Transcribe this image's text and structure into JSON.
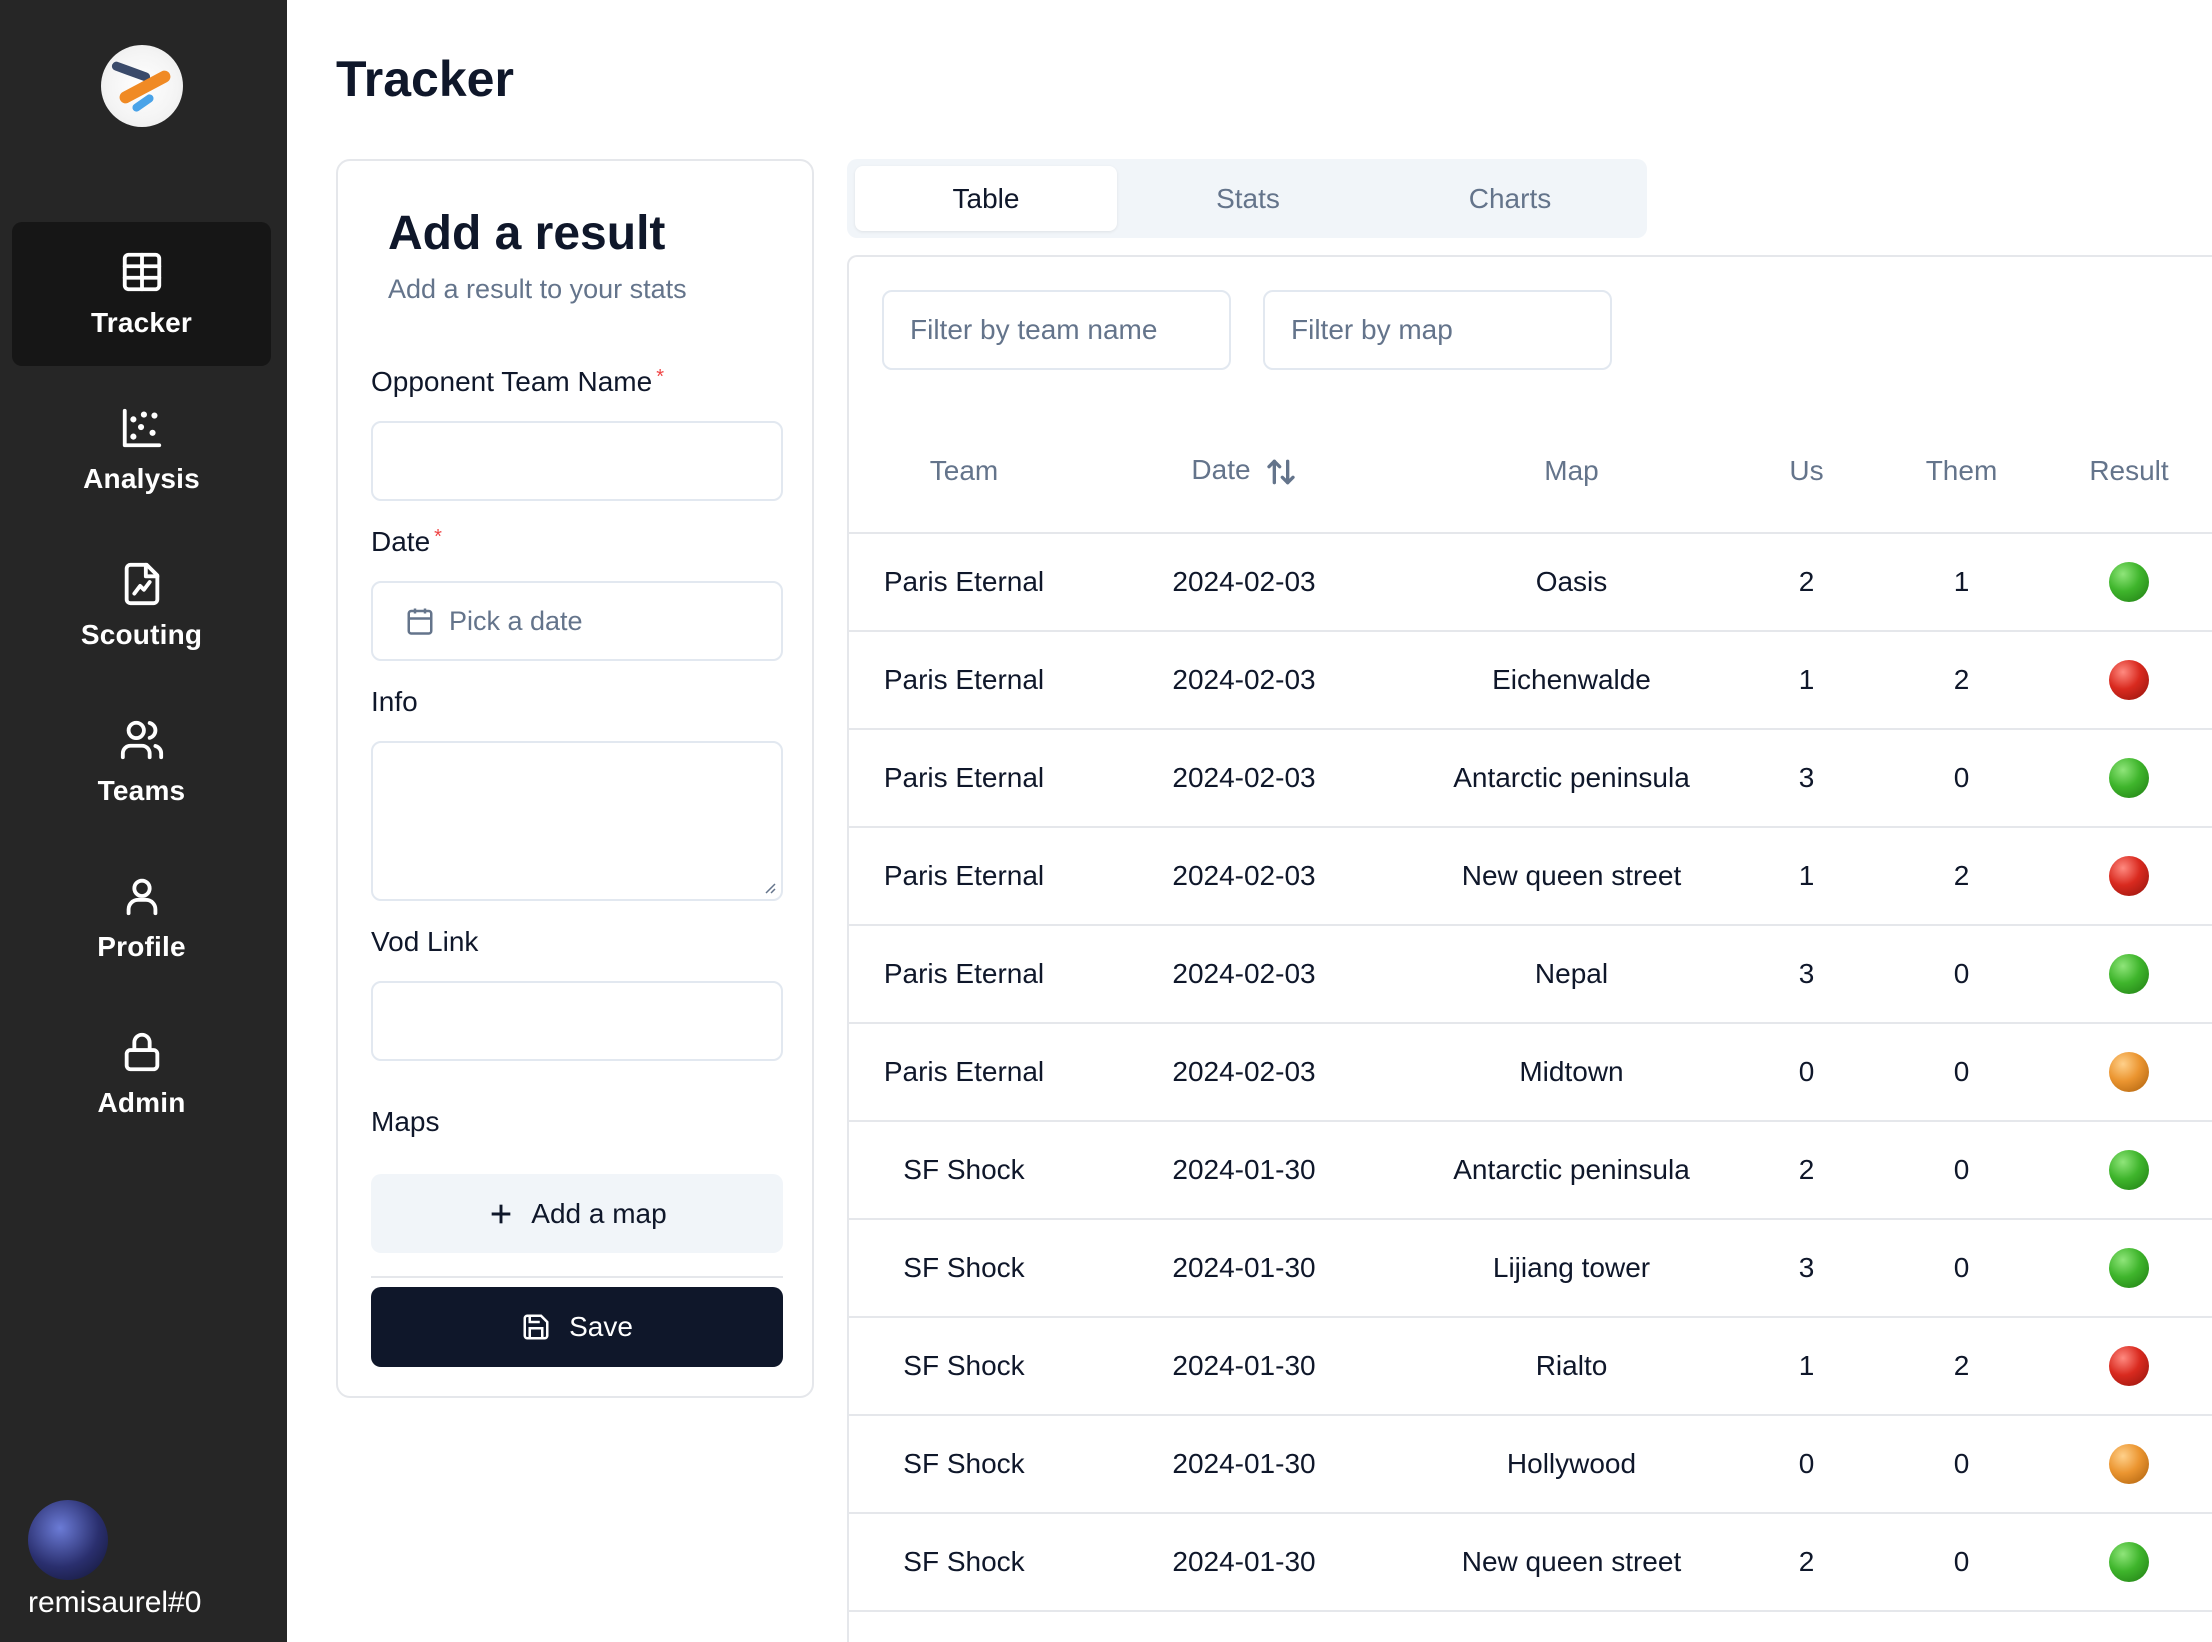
{
  "sidebar": {
    "items": [
      {
        "label": "Tracker",
        "icon": "table-icon"
      },
      {
        "label": "Analysis",
        "icon": "scatter-chart-icon"
      },
      {
        "label": "Scouting",
        "icon": "file-chart-icon"
      },
      {
        "label": "Teams",
        "icon": "users-icon"
      },
      {
        "label": "Profile",
        "icon": "user-icon"
      },
      {
        "label": "Admin",
        "icon": "lock-icon"
      }
    ],
    "active_item": "Tracker",
    "username": "remisaurel#0"
  },
  "page": {
    "title": "Tracker"
  },
  "form": {
    "title": "Add a result",
    "subtitle": "Add a result to your stats",
    "opponent_label": "Opponent Team Name",
    "date_label": "Date",
    "required_mark": "*",
    "date_placeholder": "Pick a date",
    "info_label": "Info",
    "vod_label": "Vod Link",
    "maps_label": "Maps",
    "add_map_label": "Add a map",
    "save_label": "Save"
  },
  "tabs": [
    "Table",
    "Stats",
    "Charts"
  ],
  "active_tab": "Table",
  "filters": {
    "team_placeholder": "Filter by team name",
    "map_placeholder": "Filter by map"
  },
  "table": {
    "columns": [
      "Team",
      "Date",
      "Map",
      "Us",
      "Them",
      "Result"
    ],
    "rows": [
      {
        "team": "Paris Eternal",
        "date": "2024-02-03",
        "map": "Oasis",
        "us": "2",
        "them": "1",
        "result": "win"
      },
      {
        "team": "Paris Eternal",
        "date": "2024-02-03",
        "map": "Eichenwalde",
        "us": "1",
        "them": "2",
        "result": "loss"
      },
      {
        "team": "Paris Eternal",
        "date": "2024-02-03",
        "map": "Antarctic peninsula",
        "us": "3",
        "them": "0",
        "result": "win"
      },
      {
        "team": "Paris Eternal",
        "date": "2024-02-03",
        "map": "New queen street",
        "us": "1",
        "them": "2",
        "result": "loss"
      },
      {
        "team": "Paris Eternal",
        "date": "2024-02-03",
        "map": "Nepal",
        "us": "3",
        "them": "0",
        "result": "win"
      },
      {
        "team": "Paris Eternal",
        "date": "2024-02-03",
        "map": "Midtown",
        "us": "0",
        "them": "0",
        "result": "draw"
      },
      {
        "team": "SF Shock",
        "date": "2024-01-30",
        "map": "Antarctic peninsula",
        "us": "2",
        "them": "0",
        "result": "win"
      },
      {
        "team": "SF Shock",
        "date": "2024-01-30",
        "map": "Lijiang tower",
        "us": "3",
        "them": "0",
        "result": "win"
      },
      {
        "team": "SF Shock",
        "date": "2024-01-30",
        "map": "Rialto",
        "us": "1",
        "them": "2",
        "result": "loss"
      },
      {
        "team": "SF Shock",
        "date": "2024-01-30",
        "map": "Hollywood",
        "us": "0",
        "them": "0",
        "result": "draw"
      },
      {
        "team": "SF Shock",
        "date": "2024-01-30",
        "map": "New queen street",
        "us": "2",
        "them": "0",
        "result": "win"
      }
    ]
  },
  "colors": {
    "sidebar_bg": "#262626",
    "sidebar_active": "#161616",
    "primary_button": "#0f172a",
    "win": "#3fb52c",
    "loss": "#d92a1f",
    "draw": "#eb9530"
  }
}
